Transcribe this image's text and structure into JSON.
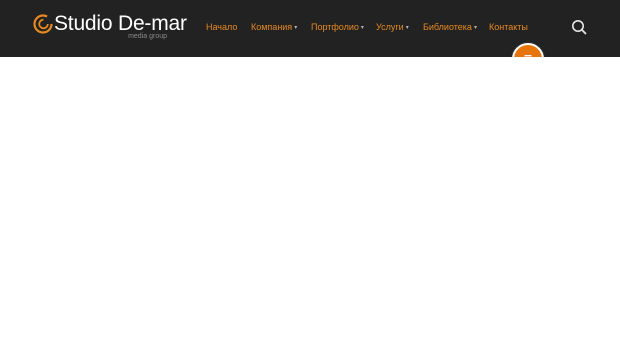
{
  "brand": {
    "name": "Studio De-mar",
    "subtitle": "media group"
  },
  "nav": {
    "items": [
      {
        "label": "Начало",
        "has_dropdown": false
      },
      {
        "label": "Компания",
        "has_dropdown": true
      },
      {
        "label": "Портфолио",
        "has_dropdown": true
      },
      {
        "label": "Услуги",
        "has_dropdown": true
      },
      {
        "label": "Библиотека",
        "has_dropdown": true
      },
      {
        "label": "Контакты",
        "has_dropdown": false
      }
    ],
    "dropdown_glyph": "▾"
  },
  "icons": {
    "search": "search-icon",
    "menu": "menu-lines-icon"
  },
  "colors": {
    "header_bg": "#222222",
    "accent": "#e8891e",
    "fab": "#e8750c",
    "page_bg": "#ffffff"
  }
}
